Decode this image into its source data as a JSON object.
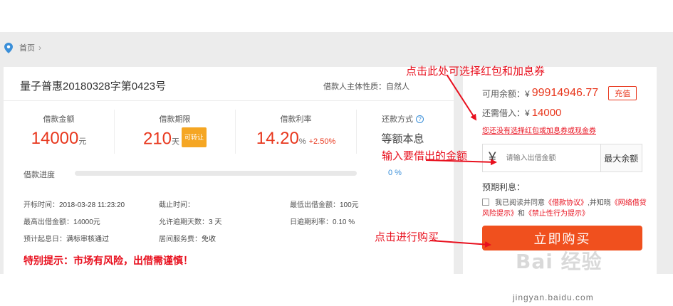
{
  "breadcrumb": {
    "home": "首页",
    "chevron": "›"
  },
  "product": {
    "title": "量子普惠20180328字第0423号",
    "borrower_type": "借款人主体性质：自然人"
  },
  "stats": {
    "amount": {
      "label": "借款金额",
      "value": "14000",
      "unit": "元"
    },
    "term": {
      "label": "借款期限",
      "value": "210",
      "unit": "天",
      "tag": "可转让"
    },
    "rate": {
      "label": "借款利率",
      "value": "14.20",
      "unit": "%",
      "extra": "+2.50%"
    },
    "repay": {
      "label": "还款方式",
      "value": "等额本息",
      "help": "?"
    }
  },
  "progress": {
    "label": "借款进度",
    "percent_text": "0 %",
    "value": 0
  },
  "info": {
    "start_time_label": "开标时间：",
    "start_time": "2018-03-28 11:23:20",
    "end_time_label": "截止时间：",
    "end_time": "",
    "min_label": "最低出借金额：",
    "min": "100元",
    "max_label": "最高出借金额：",
    "max": "14000元",
    "overdue_days_label": "允许逾期天数：",
    "overdue_days": "3 天",
    "overdue_rate_label": "日逾期利率：",
    "overdue_rate": "0.10 %",
    "interest_start_label": "预计起息日：",
    "interest_start": "满标审核通过",
    "fee_label": "居间服务费：",
    "fee": "免收"
  },
  "warning": "特别提示：市场有风险，出借需谨慎！",
  "right": {
    "available_label": "可用余额：¥",
    "available": "99914946.77",
    "recharge": "充值",
    "need_label": "还需借入：¥",
    "need": "14000",
    "coupon_link": "您还没有选择红包或加息券或现金券",
    "yen": "¥",
    "amount_placeholder": "请输入出借金额",
    "max_button": "最大余额",
    "expect_label": "预期利息：",
    "agree_prefix": "我已阅读并同意",
    "agree_link1": "《借款协议》",
    "agree_mid": ",并知晓",
    "agree_link2": "《网络借贷风险提示》",
    "agree_and": "和",
    "agree_link3": "《禁止性行为提示》",
    "buy_button": "立即购买"
  },
  "annotations": {
    "coupon": "点击此处可选择红包和加息券",
    "input": "输入要借出的金额",
    "buy": "点击进行购买"
  },
  "watermark": {
    "logo": "Bai 经验",
    "url": "jingyan.baidu.com"
  },
  "colors": {
    "accent": "#e8381e",
    "blue": "#3a8fd9",
    "button": "#f0501e",
    "annotation": "#e8101e"
  }
}
